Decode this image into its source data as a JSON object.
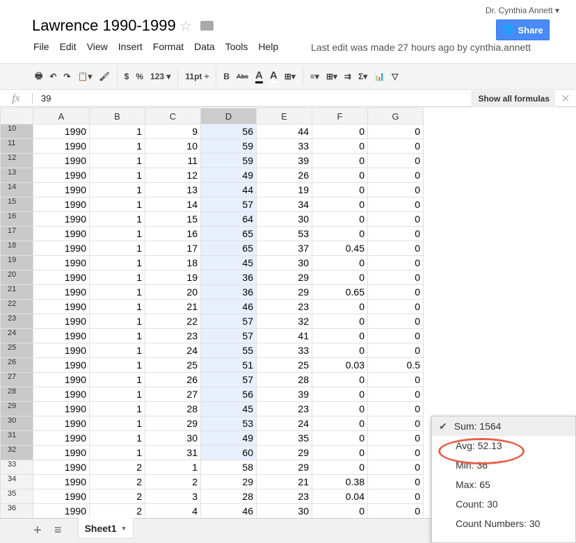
{
  "app": {
    "title": "Lawrence 1990-1999",
    "user": "Dr. Cynthia Annett ▾",
    "share_label": "Share",
    "last_edit": "Last edit was made 27 hours ago by cynthia.annett"
  },
  "menu": [
    "File",
    "Edit",
    "View",
    "Insert",
    "Format",
    "Data",
    "Tools",
    "Help"
  ],
  "toolbar": {
    "currency": "$",
    "percent": "%",
    "number_format": "123 ▾",
    "font_size": "11pt ÷",
    "bold": "B",
    "strike": "Abc",
    "text_color": "A",
    "fill_color": "A"
  },
  "formula_bar": {
    "fx": "fx",
    "value": "39",
    "show_all": "Show all formulas",
    "close": "✕"
  },
  "columns": [
    "A",
    "B",
    "C",
    "D",
    "E",
    "F",
    "G"
  ],
  "selected_column": "D",
  "rows": [
    {
      "n": "10",
      "v": [
        "1990",
        "1",
        "9",
        "56",
        "44",
        "0",
        "0"
      ]
    },
    {
      "n": "11",
      "v": [
        "1990",
        "1",
        "10",
        "59",
        "33",
        "0",
        "0"
      ]
    },
    {
      "n": "12",
      "v": [
        "1990",
        "1",
        "11",
        "59",
        "39",
        "0",
        "0"
      ]
    },
    {
      "n": "13",
      "v": [
        "1990",
        "1",
        "12",
        "49",
        "26",
        "0",
        "0"
      ]
    },
    {
      "n": "14",
      "v": [
        "1990",
        "1",
        "13",
        "44",
        "19",
        "0",
        "0"
      ]
    },
    {
      "n": "15",
      "v": [
        "1990",
        "1",
        "14",
        "57",
        "34",
        "0",
        "0"
      ]
    },
    {
      "n": "16",
      "v": [
        "1990",
        "1",
        "15",
        "64",
        "30",
        "0",
        "0"
      ]
    },
    {
      "n": "17",
      "v": [
        "1990",
        "1",
        "16",
        "65",
        "53",
        "0",
        "0"
      ]
    },
    {
      "n": "18",
      "v": [
        "1990",
        "1",
        "17",
        "65",
        "37",
        "0.45",
        "0"
      ]
    },
    {
      "n": "19",
      "v": [
        "1990",
        "1",
        "18",
        "45",
        "30",
        "0",
        "0"
      ]
    },
    {
      "n": "20",
      "v": [
        "1990",
        "1",
        "19",
        "36",
        "29",
        "0",
        "0"
      ]
    },
    {
      "n": "21",
      "v": [
        "1990",
        "1",
        "20",
        "36",
        "29",
        "0.65",
        "0"
      ]
    },
    {
      "n": "22",
      "v": [
        "1990",
        "1",
        "21",
        "46",
        "23",
        "0",
        "0"
      ]
    },
    {
      "n": "23",
      "v": [
        "1990",
        "1",
        "22",
        "57",
        "32",
        "0",
        "0"
      ]
    },
    {
      "n": "24",
      "v": [
        "1990",
        "1",
        "23",
        "57",
        "41",
        "0",
        "0"
      ]
    },
    {
      "n": "25",
      "v": [
        "1990",
        "1",
        "24",
        "55",
        "33",
        "0",
        "0"
      ]
    },
    {
      "n": "26",
      "v": [
        "1990",
        "1",
        "25",
        "51",
        "25",
        "0.03",
        "0.5"
      ]
    },
    {
      "n": "27",
      "v": [
        "1990",
        "1",
        "26",
        "57",
        "28",
        "0",
        "0"
      ]
    },
    {
      "n": "28",
      "v": [
        "1990",
        "1",
        "27",
        "56",
        "39",
        "0",
        "0"
      ]
    },
    {
      "n": "29",
      "v": [
        "1990",
        "1",
        "28",
        "45",
        "23",
        "0",
        "0"
      ]
    },
    {
      "n": "30",
      "v": [
        "1990",
        "1",
        "29",
        "53",
        "24",
        "0",
        "0"
      ]
    },
    {
      "n": "31",
      "v": [
        "1990",
        "1",
        "30",
        "49",
        "35",
        "0",
        "0"
      ]
    },
    {
      "n": "32",
      "v": [
        "1990",
        "1",
        "31",
        "60",
        "29",
        "0",
        "0"
      ]
    },
    {
      "n": "33",
      "v": [
        "1990",
        "2",
        "1",
        "58",
        "29",
        "0",
        "0"
      ]
    },
    {
      "n": "34",
      "v": [
        "1990",
        "2",
        "2",
        "29",
        "21",
        "0.38",
        "0"
      ]
    },
    {
      "n": "35",
      "v": [
        "1990",
        "2",
        "3",
        "28",
        "23",
        "0.04",
        "0"
      ]
    },
    {
      "n": "36",
      "v": [
        "1990",
        "2",
        "4",
        "46",
        "30",
        "0",
        "0"
      ]
    }
  ],
  "sheets": {
    "active": "Sheet1",
    "add": "+",
    "list": "≡"
  },
  "summary_popup": {
    "items": [
      "Sum: 1564",
      "Avg: 52.13",
      "Min: 36",
      "Max: 65",
      "Count: 30",
      "Count Numbers: 30"
    ],
    "checked": "Sum: 1564",
    "highlighted": "Avg: 52.13",
    "highlight_color": "#e8604c"
  }
}
